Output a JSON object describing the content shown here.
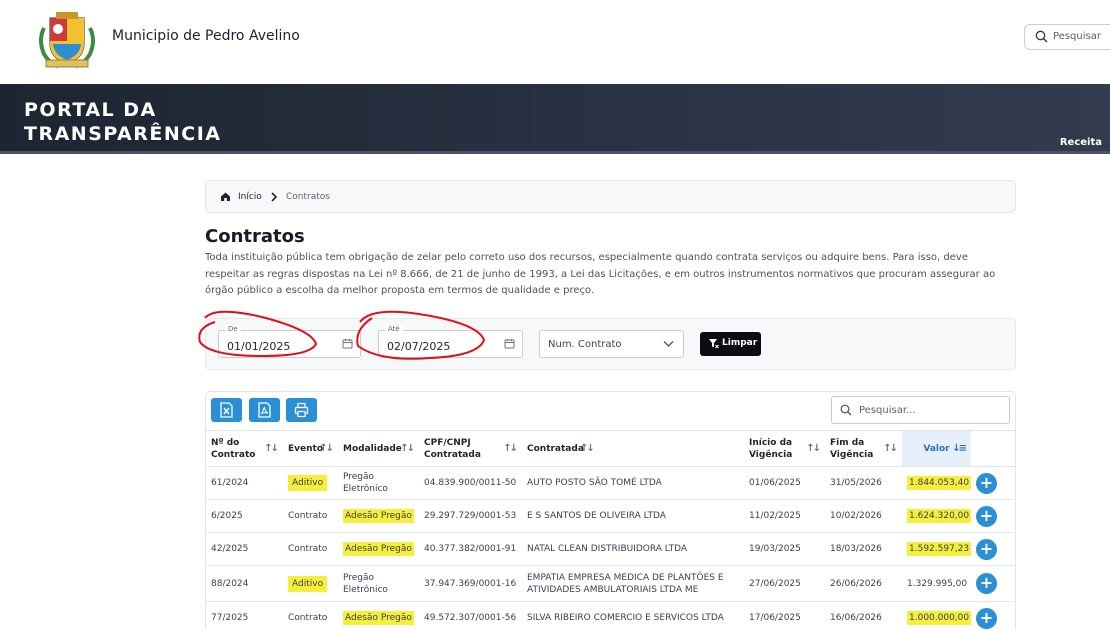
{
  "header": {
    "municipality": "Municipio de Pedro Avelino",
    "search_placeholder": "Pesquisar"
  },
  "banner": {
    "title_line1": "PORTAL DA",
    "title_line2": "TRANSPARÊNCIA",
    "receita": "Receita"
  },
  "breadcrumb": {
    "home": "Início",
    "current": "Contratos"
  },
  "page": {
    "title": "Contratos",
    "description": "Toda instituição pública tem obrigação de zelar pelo correto uso dos recursos, especialmente quando contrata serviços ou adquire bens. Para isso, deve respeitar as regras dispostas na Lei nº 8.666, de 21 de junho de 1993, a Lei das Licitações, e em outros instrumentos normativos que procuram assegurar ao órgão público a escolha da melhor proposta em termos de qualidade e preço."
  },
  "filters": {
    "from_label": "De",
    "from_value": "01/01/2025",
    "to_label": "Até",
    "to_value": "02/07/2025",
    "contract_select": "Num. Contrato",
    "clear_button": "Limpar"
  },
  "table": {
    "search_placeholder": "Pesquisar...",
    "headers": {
      "numero": "Nº do Contrato",
      "evento": "Evento",
      "modalidade": "Modalidade",
      "cnpj": "CPF/CNPJ Contratada",
      "contratada": "Contratada",
      "inicio": "Início da Vigência",
      "fim": "Fim da Vigência",
      "valor": "Valor"
    },
    "rows": [
      {
        "numero": "61/2024",
        "evento": "Aditivo",
        "modalidade": "Pregão Eletrônico",
        "cnpj": "04.839.900/0011-50",
        "contratada": "AUTO POSTO SÃO TOMÉ LTDA",
        "inicio": "01/06/2025",
        "fim": "31/05/2026",
        "valor": "1.844.053,40"
      },
      {
        "numero": "6/2025",
        "evento": "Contrato",
        "modalidade": "Adesão Pregão",
        "cnpj": "29.297.729/0001-53",
        "contratada": "E S SANTOS DE OLIVEIRA LTDA",
        "inicio": "11/02/2025",
        "fim": "10/02/2026",
        "valor": "1.624.320,00"
      },
      {
        "numero": "42/2025",
        "evento": "Contrato",
        "modalidade": "Adesão Pregão",
        "cnpj": "40.377.382/0001-91",
        "contratada": "NATAL CLEAN DISTRIBUIDORA LTDA",
        "inicio": "19/03/2025",
        "fim": "18/03/2026",
        "valor": "1.592.597,23"
      },
      {
        "numero": "88/2024",
        "evento": "Aditivo",
        "modalidade": "Pregão Eletrônico",
        "cnpj": "37.947.369/0001-16",
        "contratada": "EMPATIA EMPRESA MEDICA DE PLANTÕES E ATIVIDADES AMBULATORIAIS LTDA ME",
        "inicio": "27/06/2025",
        "fim": "26/06/2026",
        "valor": "1.329.995,00"
      },
      {
        "numero": "77/2025",
        "evento": "Contrato",
        "modalidade": "Adesão Pregão",
        "cnpj": "49.572.307/0001-56",
        "contratada": "SILVA RIBEIRO COMERCIO E SERVICOS LTDA",
        "inicio": "17/06/2025",
        "fim": "16/06/2026",
        "valor": "1.000.000,00"
      }
    ]
  },
  "colors": {
    "accent": "#2b8fd6",
    "highlight": "#f5ee3a",
    "annotation": "#e0101a",
    "banner": "#1d2533"
  }
}
